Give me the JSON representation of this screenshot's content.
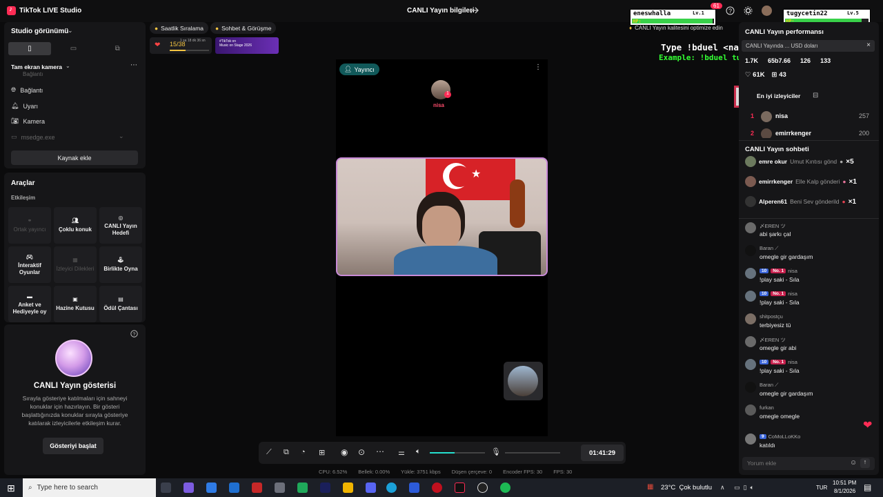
{
  "window": {
    "app_title": "TikTok LIVE Studio",
    "stream_info": "CANLI Yayın bilgileri",
    "notif_count": "61"
  },
  "left": {
    "studio_view_title": "Studio görünümü",
    "scene_title": "Tam ekran kamera",
    "sources": [
      "Bağlantı",
      "Uyarı",
      "Kamera"
    ],
    "source_partial": "Bağlantı",
    "source_dim": "msedge.exe",
    "add_source": "Kaynak ekle",
    "tools_title": "Araçlar",
    "interaction_label": "Etkileşim",
    "tools": [
      "Ortak yayıncı",
      "Çoklu konuk",
      "CANLI Yayın Hedefi",
      "İnteraktif Oyunlar",
      "İzleyici Dilekleri",
      "Birlikte Oyna",
      "Anket ve Hediyeyle oy",
      "Hazine Kutusu",
      "Ödül Çantası"
    ],
    "show_title": "CANLI Yayın gösterisi",
    "show_desc": "Sırayla gösteriye katılmaları için sahneyi konuklar için hazırlayın. Bir gösteri başlattığınızda konuklar sırayla gösteriye katılarak izleyicilerle etkileşim kurar.",
    "show_button": "Gösteriyi başlat"
  },
  "top_chips": {
    "ranking": "Saatlik Sıralama",
    "chat_meet": "Sohbet & Görüşme",
    "progress_text": "15/38",
    "timer_small": "1 sa 18 dk 36 sn",
    "banner_line1": "#TikTok on",
    "banner_line2": "Music on Stage 2026",
    "quality_tip": "CANLI Yayın kalitesini optimize edin"
  },
  "stage": {
    "host_badge": "Yayıncı",
    "guest_name": "nisa",
    "guest_level": "1"
  },
  "controls": {
    "timer": "01:41:29",
    "volume_fraction": 0.45
  },
  "stats": [
    "CPU: 6.52%",
    "Bellek: 0.00%",
    "Yükle: 3751 kbps",
    "Düşen çerçeve: 0",
    "Encoder FPS: 30",
    "FPS: 30"
  ],
  "overlay": {
    "player1_name": "eneswhalla",
    "player1_level": "Lv.1",
    "player2_name": "tugycetin22",
    "player2_level": "Lv.5",
    "hp_label": "HP:",
    "instruction": "Type !bduel <name> to play",
    "example": "Example: !bduel tugycetin22"
  },
  "right": {
    "perf_title": "CANLI Yayın performansı",
    "earn_text": "CANLI Yayında ... USD doları",
    "metrics": [
      "1.7K",
      "65b7.66",
      "126",
      "133"
    ],
    "likes": "61K",
    "gifts": "43",
    "top_viewers_tab": "En iyi izleyiciler",
    "top_viewers": [
      {
        "rank": "1",
        "name": "nisa",
        "score": "257"
      },
      {
        "rank": "2",
        "name": "emirrkenger",
        "score": "200"
      }
    ],
    "chat_title": "CANLI Yayın sohbeti",
    "gift_feed": [
      {
        "user": "emre okur",
        "text": "Umut Kıntısı gönd",
        "count": "×5"
      },
      {
        "user": "emirrkenger",
        "text": "Elle Kalp gönderi",
        "count": "×1"
      },
      {
        "user": "Alperen61",
        "text": "Beni Sev gönderild",
        "count": "×1"
      }
    ],
    "messages": [
      {
        "name": "〆EREN ツ",
        "text": "abi şarkı çal",
        "badges": ""
      },
      {
        "name": "Baran ⟋",
        "text": "omegle gir gardaşım",
        "badges": ""
      },
      {
        "name": "nisa",
        "text": "!play saki - Sıla",
        "badges": "10|No. 1"
      },
      {
        "name": "nisa",
        "text": "!play saki - Sıla",
        "badges": "10|No. 1"
      },
      {
        "name": "shitpostçu",
        "text": "terbiyesiz tü",
        "badges": ""
      },
      {
        "name": "〆EREN ツ",
        "text": "omegle gir abi",
        "badges": ""
      },
      {
        "name": "nisa",
        "text": "!play saki - Sıla",
        "badges": "10|No. 1"
      },
      {
        "name": "Baran ⟋",
        "text": "omegle gir gardaşım",
        "badges": ""
      },
      {
        "name": "furkan",
        "text": "omegle omegle",
        "badges": ""
      },
      {
        "name": "CoMoLLoKKo",
        "text": "katıldı",
        "badges": "9"
      }
    ],
    "comment_placeholder": "Yorum ekle"
  },
  "taskbar": {
    "search_placeholder": "Type here to search",
    "weather": "23°C  Çok bulutlu",
    "lang": "TUR",
    "time": "10:51 PM",
    "date": "8/1/2026"
  },
  "colors": {
    "accent": "#ff2c55",
    "teal": "#11595a",
    "overlay_green": "#33ff33",
    "bg": "#0b0b0c"
  }
}
